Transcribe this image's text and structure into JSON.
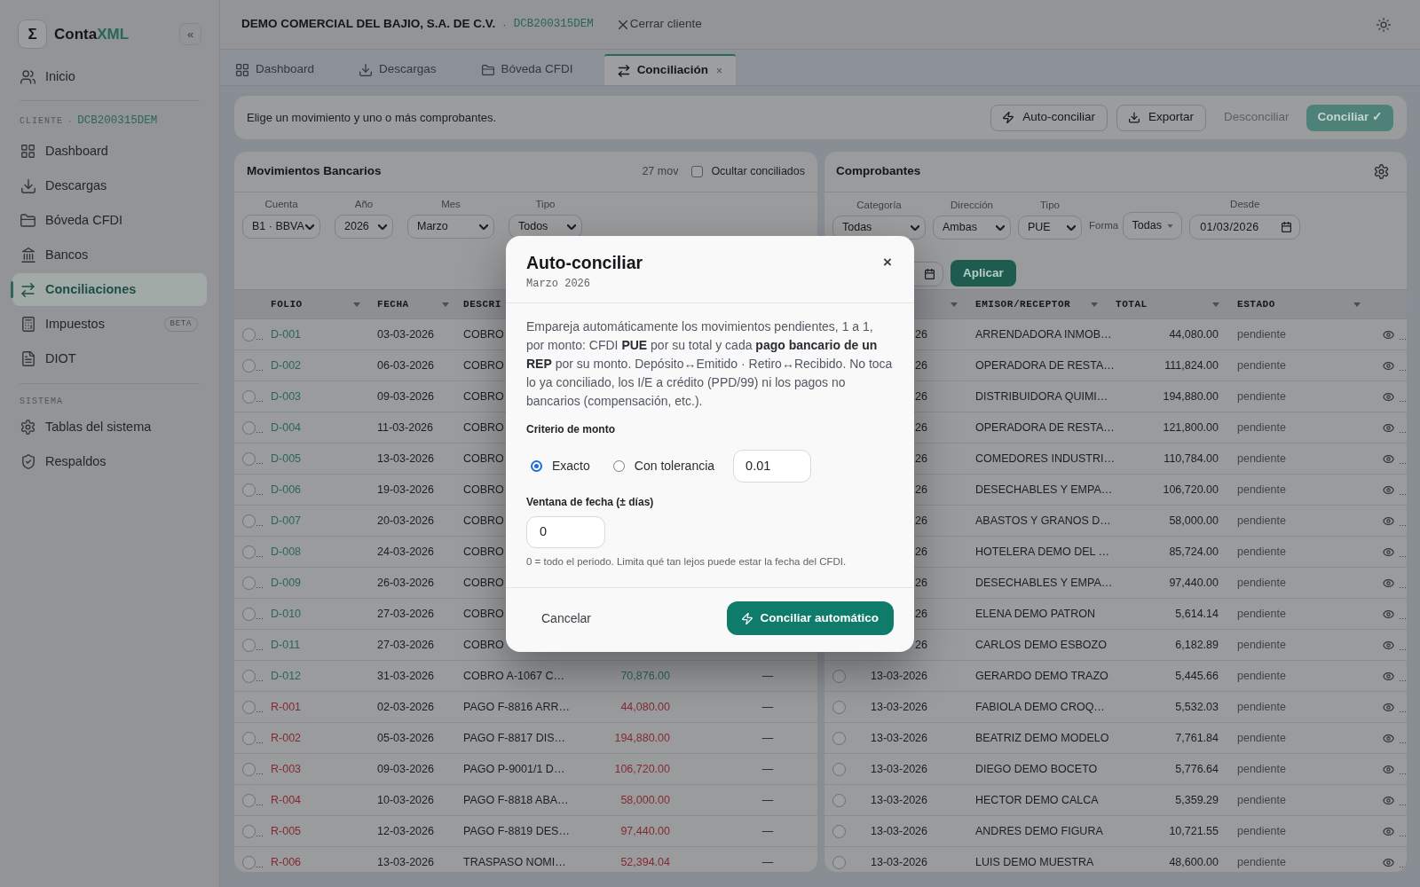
{
  "sidebar": {
    "logo": {
      "symbol": "Σ",
      "name": "Conta",
      "accent": "XML"
    },
    "collapse": "«",
    "home": {
      "label": "Inicio",
      "selected": false
    },
    "client": {
      "label": "CLIENTE",
      "separator": "·",
      "rfc": "DCB200315DEM"
    },
    "items": [
      {
        "label": "Dashboard",
        "selected": false
      },
      {
        "label": "Descargas",
        "selected": false
      },
      {
        "label": "Bóveda CFDI",
        "selected": false
      },
      {
        "label": "Bancos",
        "selected": false
      },
      {
        "label": "Conciliaciones",
        "selected": true
      },
      {
        "label": "Impuestos",
        "selected": false,
        "badge": "BETA"
      },
      {
        "label": "DIOT",
        "selected": false
      }
    ],
    "system": {
      "label": "SISTEMA",
      "items": [
        {
          "label": "Tablas del sistema",
          "selected": false
        },
        {
          "label": "Respaldos",
          "selected": false
        }
      ]
    }
  },
  "header": {
    "client_name": "DEMO COMERCIAL DEL BAJIO, S.A. DE C.V.",
    "separator": "·",
    "rfc": "DCB200315DEM",
    "close_client": "Cerrar cliente"
  },
  "tabs": [
    {
      "label": "Dashboard",
      "selected": false
    },
    {
      "label": "Descargas",
      "selected": false
    },
    {
      "label": "Bóveda CFDI",
      "selected": false
    },
    {
      "label": "Conciliación",
      "selected": true,
      "close": "×"
    }
  ],
  "toolbar": {
    "hint": "Elige un movimiento y uno o más comprobantes.",
    "buttons": [
      {
        "label": "Auto-conciliar",
        "kind": "outline",
        "disabled": false
      },
      {
        "label": "Exportar",
        "kind": "outline",
        "disabled": false
      },
      {
        "label": "Desconciliar",
        "kind": "ghost",
        "disabled": true
      },
      {
        "label": "Conciliar ✓",
        "kind": "primary",
        "disabled": true
      }
    ]
  },
  "movimientos": {
    "title": "Movimientos Bancarios",
    "count": "27 mov",
    "hide_reconciled": {
      "label": "Ocultar conciliados",
      "checked": false
    },
    "filters": [
      {
        "label": "Cuenta",
        "value": "B1 · BBVA"
      },
      {
        "label": "Año",
        "value": "2026"
      },
      {
        "label": "Mes",
        "value": "Marzo"
      },
      {
        "label": "Tipo",
        "value": "Todos"
      }
    ],
    "columns": [
      {
        "label": "FOLIO",
        "sortable": true
      },
      {
        "label": "FECHA",
        "sortable": true
      },
      {
        "label": "DESCRI",
        "sortable": false
      }
    ],
    "rows": [
      {
        "selected": false,
        "more": "…",
        "folio": "D-001",
        "fecha": "03-03-2026",
        "descripcion": "COBRO",
        "kind": "deposit"
      },
      {
        "selected": false,
        "more": "…",
        "folio": "D-002",
        "fecha": "06-03-2026",
        "descripcion": "COBRO",
        "kind": "deposit"
      },
      {
        "selected": false,
        "more": "…",
        "folio": "D-003",
        "fecha": "09-03-2026",
        "descripcion": "COBRO",
        "kind": "deposit"
      },
      {
        "selected": false,
        "more": "…",
        "folio": "D-004",
        "fecha": "11-03-2026",
        "descripcion": "COBRO",
        "kind": "deposit"
      },
      {
        "selected": false,
        "more": "…",
        "folio": "D-005",
        "fecha": "13-03-2026",
        "descripcion": "COBRO",
        "kind": "deposit"
      },
      {
        "selected": false,
        "more": "…",
        "folio": "D-006",
        "fecha": "19-03-2026",
        "descripcion": "COBRO",
        "kind": "deposit"
      },
      {
        "selected": false,
        "more": "…",
        "folio": "D-007",
        "fecha": "20-03-2026",
        "descripcion": "COBRO",
        "kind": "deposit"
      },
      {
        "selected": false,
        "more": "…",
        "folio": "D-008",
        "fecha": "24-03-2026",
        "descripcion": "COBRO",
        "kind": "deposit"
      },
      {
        "selected": false,
        "more": "…",
        "folio": "D-009",
        "fecha": "26-03-2026",
        "descripcion": "COBRO",
        "kind": "deposit"
      },
      {
        "selected": false,
        "more": "…",
        "folio": "D-010",
        "fecha": "27-03-2026",
        "descripcion": "COBRO",
        "kind": "deposit"
      },
      {
        "selected": false,
        "more": "…",
        "folio": "D-011",
        "fecha": "27-03-2026",
        "descripcion": "COBRO",
        "kind": "deposit"
      },
      {
        "selected": false,
        "more": "…",
        "folio": "D-012",
        "fecha": "31-03-2026",
        "descripcion": "COBRO A-1067 C…",
        "monto": "70,876.00",
        "conciliado": "—",
        "kind": "deposit"
      },
      {
        "selected": false,
        "more": "…",
        "folio": "R-001",
        "fecha": "02-03-2026",
        "descripcion": "PAGO F-8816 ARR…",
        "monto": "44,080.00",
        "conciliado": "—",
        "kind": "withdrawal"
      },
      {
        "selected": false,
        "more": "…",
        "folio": "R-002",
        "fecha": "05-03-2026",
        "descripcion": "PAGO F-8817 DIS…",
        "monto": "194,880.00",
        "conciliado": "—",
        "kind": "withdrawal"
      },
      {
        "selected": false,
        "more": "…",
        "folio": "R-003",
        "fecha": "09-03-2026",
        "descripcion": "PAGO P-9001/1 D…",
        "monto": "106,720.00",
        "conciliado": "—",
        "kind": "withdrawal"
      },
      {
        "selected": false,
        "more": "…",
        "folio": "R-004",
        "fecha": "10-03-2026",
        "descripcion": "PAGO F-8818 ABA…",
        "monto": "58,000.00",
        "conciliado": "—",
        "kind": "withdrawal"
      },
      {
        "selected": false,
        "more": "…",
        "folio": "R-005",
        "fecha": "12-03-2026",
        "descripcion": "PAGO F-8819 DES…",
        "monto": "97,440.00",
        "conciliado": "—",
        "kind": "withdrawal"
      },
      {
        "selected": false,
        "more": "…",
        "folio": "R-006",
        "fecha": "13-03-2026",
        "descripcion": "TRASPASO NOMI…",
        "monto": "52,394.04",
        "conciliado": "—",
        "kind": "withdrawal"
      }
    ]
  },
  "comprobantes": {
    "title": "Comprobantes",
    "filters": [
      {
        "kind": "select",
        "label": "Categoría",
        "value": "Todas"
      },
      {
        "kind": "select",
        "label": "Dirección",
        "value": "Ambas"
      },
      {
        "kind": "select",
        "label": "Tipo",
        "value": "PUE"
      },
      {
        "kind": "dropdown",
        "label": "Forma",
        "value": "Todas"
      },
      {
        "kind": "date",
        "label": "Desde",
        "value": "01/03/2026"
      },
      {
        "kind": "date"
      }
    ],
    "apply": "Aplicar",
    "columns": [
      {
        "sortable": true
      },
      {
        "label": "EMISOR/RECEPTOR",
        "sortable": true
      },
      {
        "label": "TOTAL",
        "sortable": true
      },
      {
        "label": "ESTADO",
        "sortable": true
      }
    ],
    "rows": [
      {
        "fecha": "26",
        "emisor": "ARRENDADORA INMOB…",
        "total": "44,080.00",
        "estado": "pendiente",
        "more": "…"
      },
      {
        "fecha": "26",
        "emisor": "OPERADORA DE RESTA…",
        "total": "111,824.00",
        "estado": "pendiente",
        "more": "…"
      },
      {
        "fecha": "26",
        "emisor": "DISTRIBUIDORA QUIMI…",
        "total": "194,880.00",
        "estado": "pendiente",
        "more": "…"
      },
      {
        "fecha": "26",
        "emisor": "OPERADORA DE RESTA…",
        "total": "121,800.00",
        "estado": "pendiente",
        "more": "…"
      },
      {
        "fecha": "26",
        "emisor": "COMEDORES INDUSTRI…",
        "total": "110,784.00",
        "estado": "pendiente",
        "more": "…"
      },
      {
        "fecha": "26",
        "emisor": "DESECHABLES Y EMPA…",
        "total": "106,720.00",
        "estado": "pendiente",
        "more": "…"
      },
      {
        "fecha": "26",
        "emisor": "ABASTOS Y GRANOS D…",
        "total": "58,000.00",
        "estado": "pendiente",
        "more": "…"
      },
      {
        "fecha": "26",
        "emisor": "HOTELERA DEMO DEL …",
        "total": "85,724.00",
        "estado": "pendiente",
        "more": "…"
      },
      {
        "fecha": "26",
        "emisor": "DESECHABLES Y EMPA…",
        "total": "97,440.00",
        "estado": "pendiente",
        "more": "…"
      },
      {
        "fecha": "26",
        "emisor": "ELENA DEMO PATRON",
        "total": "5,614.14",
        "estado": "pendiente",
        "more": "…"
      },
      {
        "fecha": "26",
        "emisor": "CARLOS DEMO ESBOZO",
        "total": "6,182.89",
        "estado": "pendiente",
        "more": "…"
      },
      {
        "selected": false,
        "fecha": "13-03-2026",
        "emisor": "GERARDO DEMO TRAZO",
        "total": "5,445.66",
        "estado": "pendiente",
        "more": "…"
      },
      {
        "selected": false,
        "fecha": "13-03-2026",
        "emisor": "FABIOLA DEMO CROQ…",
        "total": "5,532.03",
        "estado": "pendiente",
        "more": "…"
      },
      {
        "selected": false,
        "fecha": "13-03-2026",
        "emisor": "BEATRIZ DEMO MODELO",
        "total": "7,761.84",
        "estado": "pendiente",
        "more": "…"
      },
      {
        "selected": false,
        "fecha": "13-03-2026",
        "emisor": "DIEGO DEMO BOCETO",
        "total": "5,776.64",
        "estado": "pendiente",
        "more": "…"
      },
      {
        "selected": false,
        "fecha": "13-03-2026",
        "emisor": "HECTOR DEMO CALCA",
        "total": "5,359.29",
        "estado": "pendiente",
        "more": "…"
      },
      {
        "selected": false,
        "fecha": "13-03-2026",
        "emisor": "ANDRES DEMO FIGURA",
        "total": "10,721.55",
        "estado": "pendiente",
        "more": "…"
      },
      {
        "selected": false,
        "fecha": "13-03-2026",
        "emisor": "LUIS DEMO MUESTRA",
        "total": "48,600.00",
        "estado": "pendiente",
        "more": "…"
      }
    ]
  },
  "dialog": {
    "title": "Auto-conciliar",
    "subtitle": "Marzo 2026",
    "close": "×",
    "description": "Empareja automáticamente los movimientos pendientes, 1 a 1, por monto: CFDI **PUE** por su total y cada **pago bancario de un REP** por su monto. Depósito↔Emitido · Retiro↔Recibido. No toca lo ya conciliado, los I/E a crédito (PPD/99) ni los pagos no bancarios (compensación, etc.).",
    "amount": {
      "label": "Criterio de monto",
      "options": [
        {
          "label": "Exacto",
          "selected": true
        },
        {
          "label": "Con tolerancia",
          "selected": false
        }
      ],
      "tolerance": "0.01"
    },
    "date_window": {
      "label": "Ventana de fecha (± días)",
      "value": "0",
      "help": "0 = todo el periodo. Limita qué tan lejos puede estar la fecha del CFDI."
    },
    "buttons": [
      {
        "label": "Cancelar",
        "kind": "ghost"
      },
      {
        "label": "Conciliar automático",
        "kind": "primary"
      }
    ]
  }
}
